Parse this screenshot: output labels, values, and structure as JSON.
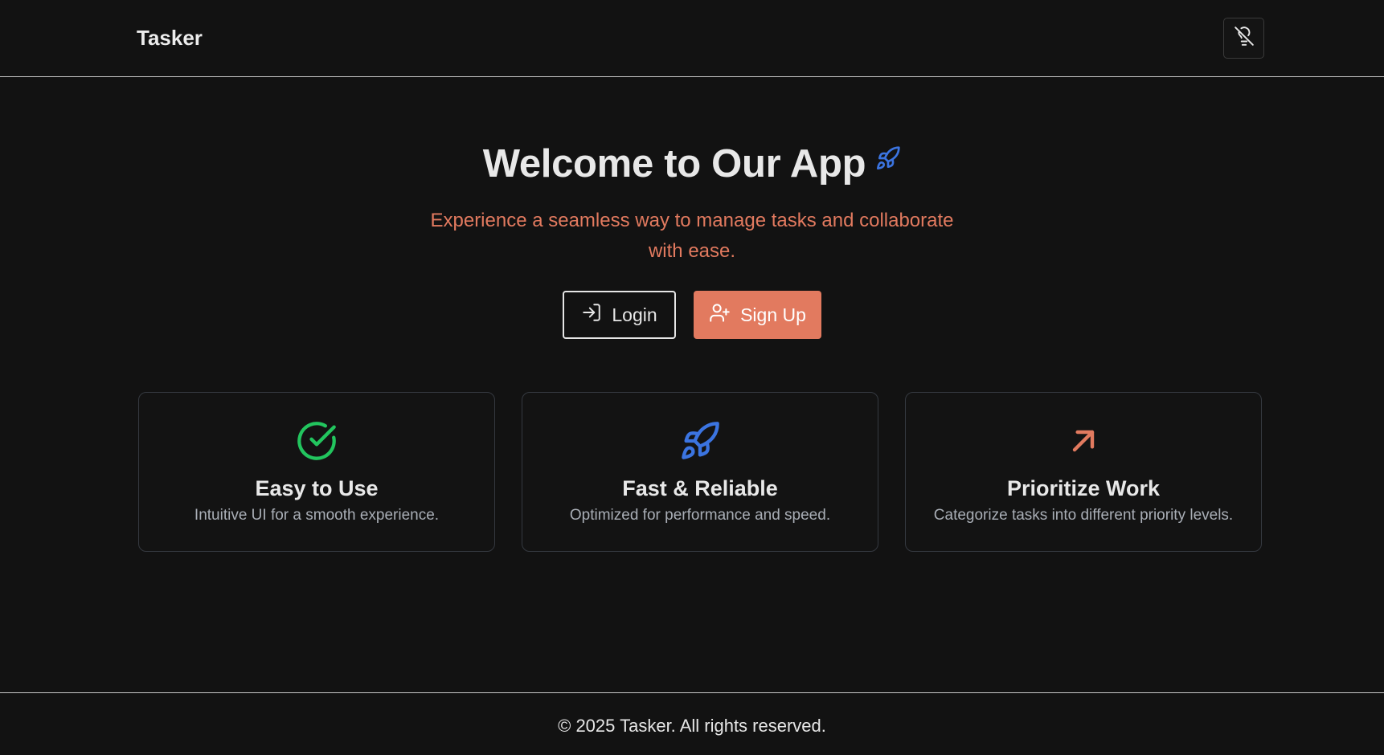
{
  "header": {
    "brand": "Tasker",
    "theme_toggle_icon": "lightbulb-off-icon"
  },
  "hero": {
    "title": "Welcome to Our App",
    "title_icon": "rocket-icon",
    "subtitle": "Experience a seamless way to manage tasks and collaborate with ease.",
    "login_label": "Login",
    "login_icon": "login-icon",
    "signup_label": "Sign Up",
    "signup_icon": "user-plus-icon"
  },
  "features": [
    {
      "title": "Easy to Use",
      "description": "Intuitive UI for a smooth experience.",
      "icon": "check-circle-icon",
      "color": "#22c55e"
    },
    {
      "title": "Fast & Reliable",
      "description": "Optimized for performance and speed.",
      "icon": "rocket-icon",
      "color": "#3b74e0"
    },
    {
      "title": "Prioritize Work",
      "description": "Categorize tasks into different priority levels.",
      "icon": "arrow-up-right-icon",
      "color": "#e27a5f"
    }
  ],
  "footer": {
    "text": "© 2025 Tasker. All rights reserved."
  },
  "colors": {
    "background": "#121212",
    "accent": "#e27a5f",
    "rocket_blue": "#3b74e0",
    "success_green": "#22c55e"
  }
}
